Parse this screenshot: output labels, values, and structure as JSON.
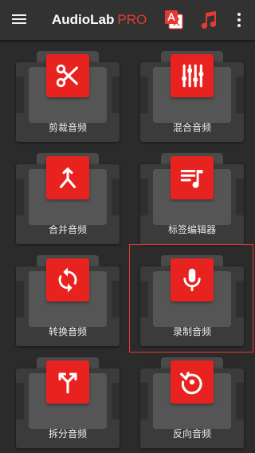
{
  "header": {
    "title_main": "AudioLab",
    "title_pro": "PRO",
    "icons": {
      "menu": "hamburger-menu-icon",
      "translate": "translate-icon",
      "music": "music-note-icon",
      "more": "more-vert-icon"
    }
  },
  "colors": {
    "background": "#2b2b2b",
    "toolbar": "#323232",
    "accent": "#e8231f"
  },
  "tools": [
    {
      "label": "剪裁音频",
      "icon": "scissors-icon"
    },
    {
      "label": "混合音频",
      "icon": "equalizer-icon"
    },
    {
      "label": "合并音频",
      "icon": "merge-icon"
    },
    {
      "label": "标签编辑器",
      "icon": "playlist-music-icon"
    },
    {
      "label": "转换音频",
      "icon": "sync-icon"
    },
    {
      "label": "录制音频",
      "icon": "microphone-icon",
      "selected": true
    },
    {
      "label": "拆分音频",
      "icon": "call-split-icon"
    },
    {
      "label": "反向音频",
      "icon": "history-reverse-icon"
    }
  ]
}
